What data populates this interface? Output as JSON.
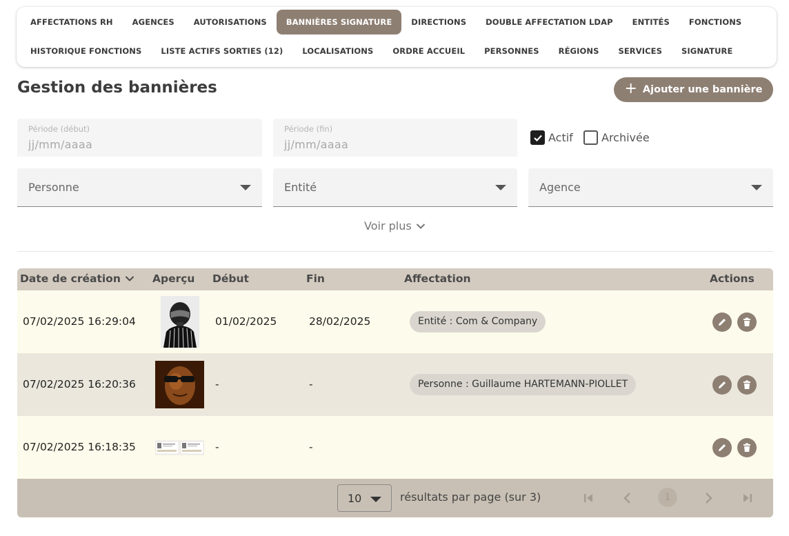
{
  "tabs": {
    "row1": [
      "AFFECTATIONS RH",
      "AGENCES",
      "AUTORISATIONS",
      "BANNIÈRES SIGNATURE",
      "DIRECTIONS",
      "DOUBLE AFFECTATION LDAP",
      "ENTITÉS",
      "FONCTIONS"
    ],
    "row2": [
      "HISTORIQUE FONCTIONS",
      "LISTE ACTIFS SORTIES (12)",
      "LOCALISATIONS",
      "ORDRE ACCUEIL",
      "PERSONNES",
      "RÉGIONS",
      "SERVICES",
      "SIGNATURE"
    ],
    "active": "BANNIÈRES SIGNATURE"
  },
  "page": {
    "title": "Gestion des bannières",
    "add_button": "Ajouter une bannière"
  },
  "filters": {
    "start_label": "Période (début)",
    "start_placeholder": "jj/mm/aaaa",
    "end_label": "Période (fin)",
    "end_placeholder": "jj/mm/aaaa",
    "actif_label": "Actif",
    "actif_checked": true,
    "archivee_label": "Archivée",
    "archivee_checked": false,
    "personne": "Personne",
    "entite": "Entité",
    "agence": "Agence",
    "more": "Voir plus"
  },
  "table": {
    "headers": {
      "created": "Date de création",
      "preview": "Aperçu",
      "start": "Début",
      "end": "Fin",
      "assignment": "Affectation",
      "actions": "Actions"
    },
    "rows": [
      {
        "created": "07/02/2025 16:29:04",
        "start": "01/02/2025",
        "end": "28/02/2025",
        "assignment": "Entité : Com & Company"
      },
      {
        "created": "07/02/2025 16:20:36",
        "start": "-",
        "end": "-",
        "assignment": "Personne : Guillaume HARTEMANN-PIOLLET"
      },
      {
        "created": "07/02/2025 16:18:35",
        "start": "-",
        "end": "-",
        "assignment": ""
      }
    ]
  },
  "pagination": {
    "per_page": "10",
    "label": "résultats par page (sur 3)",
    "current_page": "1"
  },
  "colors": {
    "accent": "#8e7f73",
    "header_bg": "#d3cbc0",
    "row_odd": "#fdfbeb",
    "row_even": "#ebe7dc",
    "pager_bg": "#c8c0b4"
  }
}
